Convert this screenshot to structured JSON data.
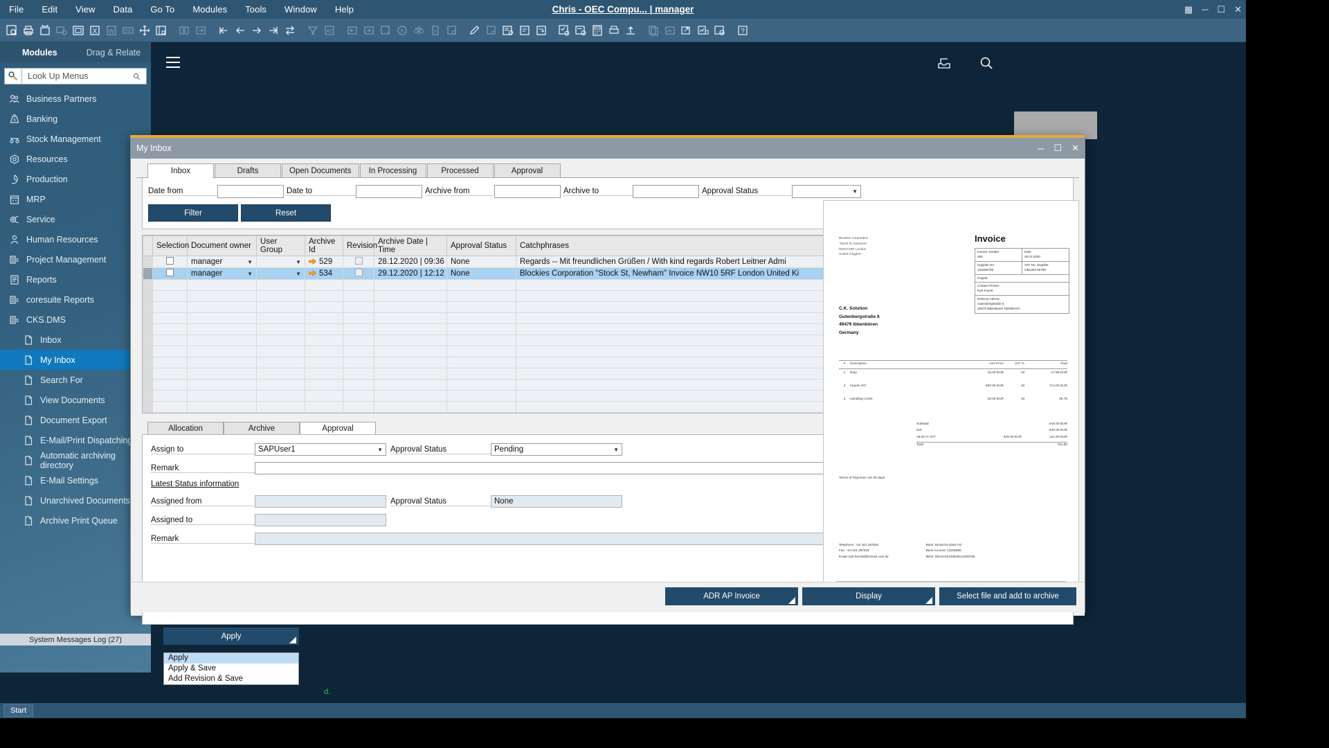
{
  "app": {
    "title": "Chris - OEC Compu... | manager",
    "menus": [
      "File",
      "Edit",
      "View",
      "Data",
      "Go To",
      "Modules",
      "Tools",
      "Window",
      "Help"
    ],
    "window_controls": [
      "grid-icon",
      "minimize",
      "maximize",
      "close"
    ],
    "status_log": "System Messages Log (27)",
    "start_button": "Start"
  },
  "modules_panel": {
    "tab_modules": "Modules",
    "tab_drag_relate": "Drag & Relate",
    "search_placeholder": "Look Up Menus",
    "search_icon": "magnifier-wrench-icon",
    "items": [
      {
        "label": "Business Partners",
        "icon": "partners-icon",
        "level": 0,
        "active": false
      },
      {
        "label": "Banking",
        "icon": "money-bag-icon",
        "level": 0,
        "active": false
      },
      {
        "label": "Stock Management",
        "icon": "stock-icon",
        "level": 0,
        "active": false
      },
      {
        "label": "Resources",
        "icon": "resources-icon",
        "level": 0,
        "active": false
      },
      {
        "label": "Production",
        "icon": "production-icon",
        "level": 0,
        "active": false
      },
      {
        "label": "MRP",
        "icon": "mrp-icon",
        "level": 0,
        "active": false
      },
      {
        "label": "Service",
        "icon": "service-icon",
        "level": 0,
        "active": false
      },
      {
        "label": "Human Resources",
        "icon": "person-icon",
        "level": 0,
        "active": false
      },
      {
        "label": "Project Management",
        "icon": "project-icon",
        "level": 0,
        "active": false
      },
      {
        "label": "Reports",
        "icon": "reports-icon",
        "level": 0,
        "active": false
      },
      {
        "label": "coresuite Reports",
        "icon": "project-icon",
        "level": 0,
        "active": false
      },
      {
        "label": "CKS.DMS",
        "icon": "project-icon",
        "level": 0,
        "active": false
      },
      {
        "label": "Inbox",
        "icon": "document-icon",
        "level": 1,
        "active": false
      },
      {
        "label": "My Inbox",
        "icon": "document-icon",
        "level": 1,
        "active": true
      },
      {
        "label": "Search For",
        "icon": "document-icon",
        "level": 1,
        "active": false
      },
      {
        "label": "View Documents",
        "icon": "document-icon",
        "level": 1,
        "active": false
      },
      {
        "label": "Document Export",
        "icon": "document-icon",
        "level": 1,
        "active": false
      },
      {
        "label": "E-Mail/Print Dispatching",
        "icon": "document-icon",
        "level": 1,
        "active": false
      },
      {
        "label": "Automatic archiving directory",
        "icon": "document-icon",
        "level": 1,
        "active": false
      },
      {
        "label": "E-Mail Settings",
        "icon": "document-icon",
        "level": 1,
        "active": false
      },
      {
        "label": "Unarchived Documents",
        "icon": "document-icon",
        "level": 1,
        "active": false
      },
      {
        "label": "Archive Print Queue",
        "icon": "document-icon",
        "level": 1,
        "active": false
      }
    ]
  },
  "modal": {
    "title": "My Inbox",
    "tabs": [
      {
        "label": "Inbox",
        "active": true
      },
      {
        "label": "Drafts",
        "active": false
      },
      {
        "label": "Open Documents",
        "active": false
      },
      {
        "label": "In Processing",
        "active": false
      },
      {
        "label": "Processed",
        "active": false
      },
      {
        "label": "Approval",
        "active": false
      }
    ],
    "filter": {
      "date_from_label": "Date from",
      "date_from_value": "",
      "date_to_label": "Date to",
      "date_to_value": "",
      "archive_from_label": "Archive from",
      "archive_from_value": "",
      "archive_to_label": "Archive to",
      "archive_to_value": "",
      "approval_status_label": "Approval Status",
      "approval_status_value": "",
      "filter_button": "Filter",
      "reset_button": "Reset"
    },
    "grid": {
      "columns": [
        "Selection",
        "Document owner",
        "User Group",
        "Archive Id",
        "Revision",
        "Archive Date | Time",
        "Approval Status",
        "Catchphrases"
      ],
      "rows": [
        {
          "selected": false,
          "selection": false,
          "document_owner": "manager",
          "user_group": "",
          "archive_id": "529",
          "revision": false,
          "archive_datetime": "28.12.2020 | 09:36",
          "approval_status": "None",
          "catchphrases": "Regards   --  Mit freundlichen Grüßen / With kind regards  Robert Leitner  Admi"
        },
        {
          "selected": true,
          "selection": false,
          "document_owner": "manager",
          "user_group": "",
          "archive_id": "534",
          "revision": false,
          "archive_datetime": "29.12.2020 | 12:12",
          "approval_status": "None",
          "catchphrases": "Blockies Corporation   \"Stock St, Newham\"  Invoice  NW10 5RF London  United Ki"
        }
      ],
      "empty_row_count": 12
    },
    "detail_tabs": [
      {
        "label": "Allocation",
        "active": false
      },
      {
        "label": "Archive",
        "active": false
      },
      {
        "label": "Approval",
        "active": true
      }
    ],
    "approval_form": {
      "assign_to_label": "Assign to",
      "assign_to_value": "SAPUser1",
      "approval_status_label": "Approval Status",
      "approval_status_value": "Pending",
      "remark_label": "Remark",
      "remark_value": "",
      "section_title": "Latest Status information",
      "assigned_from_label": "Assigned from",
      "assigned_from_value": "",
      "latest_approval_status_label": "Approval Status",
      "latest_approval_status_value": "None",
      "assigned_to_label": "Assigned to",
      "assigned_to_value": "",
      "latest_remark_label": "Remark",
      "latest_remark_value": ""
    },
    "apply_button": "Apply",
    "apply_menu": [
      {
        "label": "Apply",
        "highlighted": true
      },
      {
        "label": "Apply & Save",
        "highlighted": false
      },
      {
        "label": "Add Revision & Save",
        "highlighted": false
      }
    ],
    "footer_buttons": [
      {
        "label": "ADR AP Invoice",
        "split": true
      },
      {
        "label": "Display",
        "split": true
      },
      {
        "label": "Select file and add to archive",
        "split": false
      }
    ]
  },
  "preview": {
    "sender_lines": [
      "Blockies Corporation",
      "\"Stock St, Newham\"",
      "NW10 5RF London",
      "United Kingdom"
    ],
    "heading": "Invoice",
    "meta": [
      {
        "left_label": "Invoice number",
        "left_value": "465",
        "right_label": "Date",
        "right_value": "28.01.2020"
      },
      {
        "left_label": "Supplier No.",
        "left_value": "123456789",
        "right_label": "VAT No. Supplier",
        "right_value": "GB1324 65798"
      },
      {
        "left_label": "Projekt",
        "left_value": "",
        "right_label": "",
        "right_value": ""
      },
      {
        "left_label": "Contact Person",
        "left_value": "Karl Fuerst",
        "right_label": "",
        "right_value": ""
      },
      {
        "left_label": "Delivery Adress",
        "left_value": "Gutenbergstraße 6",
        "right_label": "",
        "right_value": "49479 Ibbenbüren GERMANY"
      }
    ],
    "recipient_lines": [
      "C.K. Solution",
      "Gutenbergstraße 6",
      "49479 Ibbenbüren",
      "Germany"
    ],
    "items_header": [
      "#",
      "Description",
      "Unit Price",
      "VAT %",
      "Total"
    ],
    "items": [
      {
        "no": "1",
        "description": "Duty",
        "unit_price": "15.00 EUR",
        "vat": "19",
        "total": "17.85 EUR"
      },
      {
        "no": "2",
        "description": "Import VAT",
        "unit_price": "600.00 EUR",
        "vat": "19",
        "total": "714,00 EUR"
      },
      {
        "no": "3",
        "description": "Handling Costs",
        "unit_price": "25.00 EUR",
        "vat": "19",
        "total": "29,75"
      }
    ],
    "totals": [
      {
        "label": "Subtotal",
        "mid": "",
        "value": "640.00 EUR"
      },
      {
        "label": "Net",
        "mid": "",
        "value": "640.00 EUR"
      },
      {
        "label": "19.00 % VAT",
        "mid": "640.00 EUR",
        "value": "121.60 EUR"
      },
      {
        "label": "Total",
        "mid": "",
        "value": "761,60"
      }
    ],
    "terms": "Terms of Payment: net 30 days",
    "footer_left": [
      "Telephone:  +44 201 287920",
      "Fax: +44 201 287929",
      "Email: karl.fuerst@blockies.com.uk"
    ],
    "footer_right": [
      "Bank: Deutsche Bank AG",
      "Bank Account: 13226656",
      "IBAN: DE22100100500123456789"
    ]
  },
  "colors": {
    "menubar": "#2e5572",
    "toolbar": "#3e6484",
    "accent_dark_button": "#224a6b",
    "modal_titlebar": "#8d9aa6",
    "modal_top_border": "#e8a83a",
    "selected_row": "#a8d1f2",
    "active_nav": "#1079bd",
    "arrow_marker": "#f0a020",
    "status_green": "#27c24c"
  }
}
